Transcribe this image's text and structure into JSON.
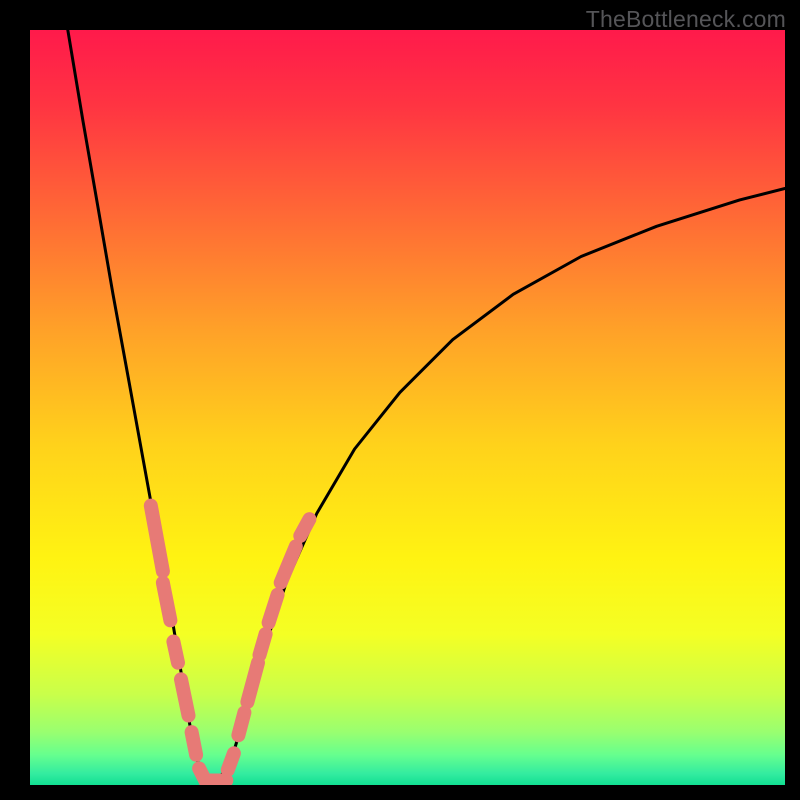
{
  "watermark": "TheBottleneck.com",
  "chart_data": {
    "type": "line",
    "title": "",
    "xlabel": "",
    "ylabel": "",
    "xlim": [
      0,
      1
    ],
    "ylim": [
      0,
      1
    ],
    "background_gradient_stops": [
      {
        "offset": 0.0,
        "color": "#ff1a4b"
      },
      {
        "offset": 0.1,
        "color": "#ff3442"
      },
      {
        "offset": 0.25,
        "color": "#ff6b35"
      },
      {
        "offset": 0.4,
        "color": "#ffa228"
      },
      {
        "offset": 0.55,
        "color": "#ffd21b"
      },
      {
        "offset": 0.7,
        "color": "#fff312"
      },
      {
        "offset": 0.8,
        "color": "#f4ff24"
      },
      {
        "offset": 0.88,
        "color": "#c9ff4a"
      },
      {
        "offset": 0.93,
        "color": "#99ff70"
      },
      {
        "offset": 0.96,
        "color": "#66ff8e"
      },
      {
        "offset": 0.985,
        "color": "#33eca0"
      },
      {
        "offset": 1.0,
        "color": "#11df92"
      }
    ],
    "curve": {
      "description": "Asymmetric V-shaped bottleneck curve: steep left arm from top-left corner to valley near x≈0.23, flat bottom along y≈0.005, then rising right arm with decreasing slope to upper-right edge near y≈0.78.",
      "x": [
        0.05,
        0.07,
        0.09,
        0.11,
        0.13,
        0.15,
        0.17,
        0.19,
        0.205,
        0.215,
        0.225,
        0.235,
        0.245,
        0.255,
        0.27,
        0.29,
        0.31,
        0.34,
        0.38,
        0.43,
        0.49,
        0.56,
        0.64,
        0.73,
        0.83,
        0.94,
        1.0
      ],
      "y": [
        1.0,
        0.88,
        0.765,
        0.65,
        0.54,
        0.43,
        0.32,
        0.21,
        0.12,
        0.06,
        0.02,
        0.006,
        0.006,
        0.015,
        0.045,
        0.11,
        0.18,
        0.27,
        0.36,
        0.445,
        0.52,
        0.59,
        0.65,
        0.7,
        0.74,
        0.775,
        0.79
      ],
      "stroke": "#000000",
      "stroke_width": 3
    },
    "accent_segments": {
      "description": "Short salmon-colored capsule segments overlaid along the lower portion of both arms and across the valley floor.",
      "color": "#e77a76",
      "width": 14,
      "segments": [
        {
          "x1": 0.16,
          "y1": 0.37,
          "x2": 0.176,
          "y2": 0.283
        },
        {
          "x1": 0.176,
          "y1": 0.268,
          "x2": 0.186,
          "y2": 0.218
        },
        {
          "x1": 0.19,
          "y1": 0.19,
          "x2": 0.196,
          "y2": 0.162
        },
        {
          "x1": 0.2,
          "y1": 0.14,
          "x2": 0.21,
          "y2": 0.092
        },
        {
          "x1": 0.214,
          "y1": 0.07,
          "x2": 0.22,
          "y2": 0.04
        },
        {
          "x1": 0.224,
          "y1": 0.022,
          "x2": 0.23,
          "y2": 0.01
        },
        {
          "x1": 0.232,
          "y1": 0.006,
          "x2": 0.26,
          "y2": 0.006
        },
        {
          "x1": 0.262,
          "y1": 0.02,
          "x2": 0.27,
          "y2": 0.042
        },
        {
          "x1": 0.276,
          "y1": 0.066,
          "x2": 0.284,
          "y2": 0.096
        },
        {
          "x1": 0.288,
          "y1": 0.11,
          "x2": 0.302,
          "y2": 0.162
        },
        {
          "x1": 0.304,
          "y1": 0.172,
          "x2": 0.312,
          "y2": 0.2
        },
        {
          "x1": 0.316,
          "y1": 0.215,
          "x2": 0.328,
          "y2": 0.252
        },
        {
          "x1": 0.332,
          "y1": 0.268,
          "x2": 0.352,
          "y2": 0.316
        },
        {
          "x1": 0.358,
          "y1": 0.33,
          "x2": 0.37,
          "y2": 0.352
        }
      ]
    }
  }
}
